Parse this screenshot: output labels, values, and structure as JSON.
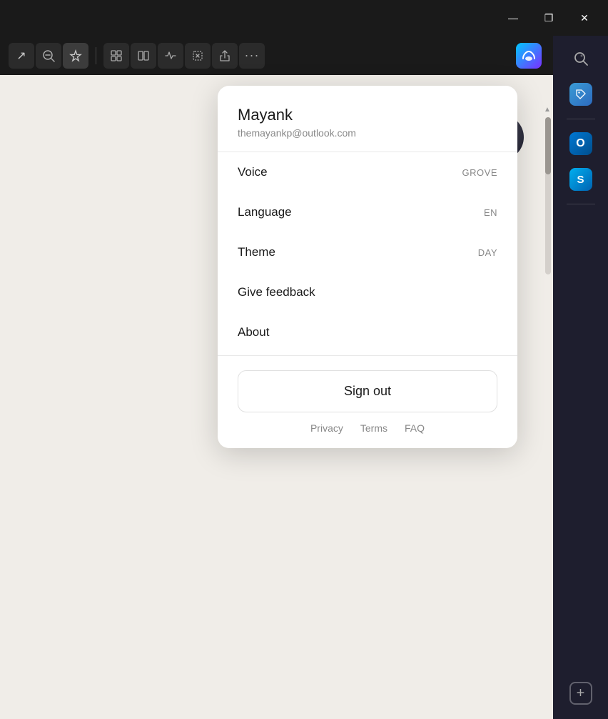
{
  "titlebar": {
    "minimize_label": "—",
    "restore_label": "❐",
    "close_label": "✕"
  },
  "toolbar": {
    "open_tab_icon": "↗",
    "zoom_out_icon": "🔍",
    "favorite_icon": "☆",
    "puzzle_icon": "🧩",
    "columns_icon": "▣",
    "heart_monitor_icon": "💓",
    "screenshot_icon": "⬚",
    "share_icon": "↑",
    "more_icon": "···"
  },
  "sidebar": {
    "search_icon": "🔍",
    "tag_icon": "🏷",
    "outlook_icon": "O",
    "skype_icon": "S",
    "add_icon": "+"
  },
  "profile": {
    "name": "Mayank",
    "email": "themayankp@outlook.com",
    "voice_label": "Voice",
    "voice_value": "GROVE",
    "language_label": "Language",
    "language_value": "EN",
    "theme_label": "Theme",
    "theme_value": "DAY",
    "feedback_label": "Give feedback",
    "about_label": "About",
    "sign_out_label": "Sign out",
    "privacy_label": "Privacy",
    "terms_label": "Terms",
    "faq_label": "FAQ"
  }
}
